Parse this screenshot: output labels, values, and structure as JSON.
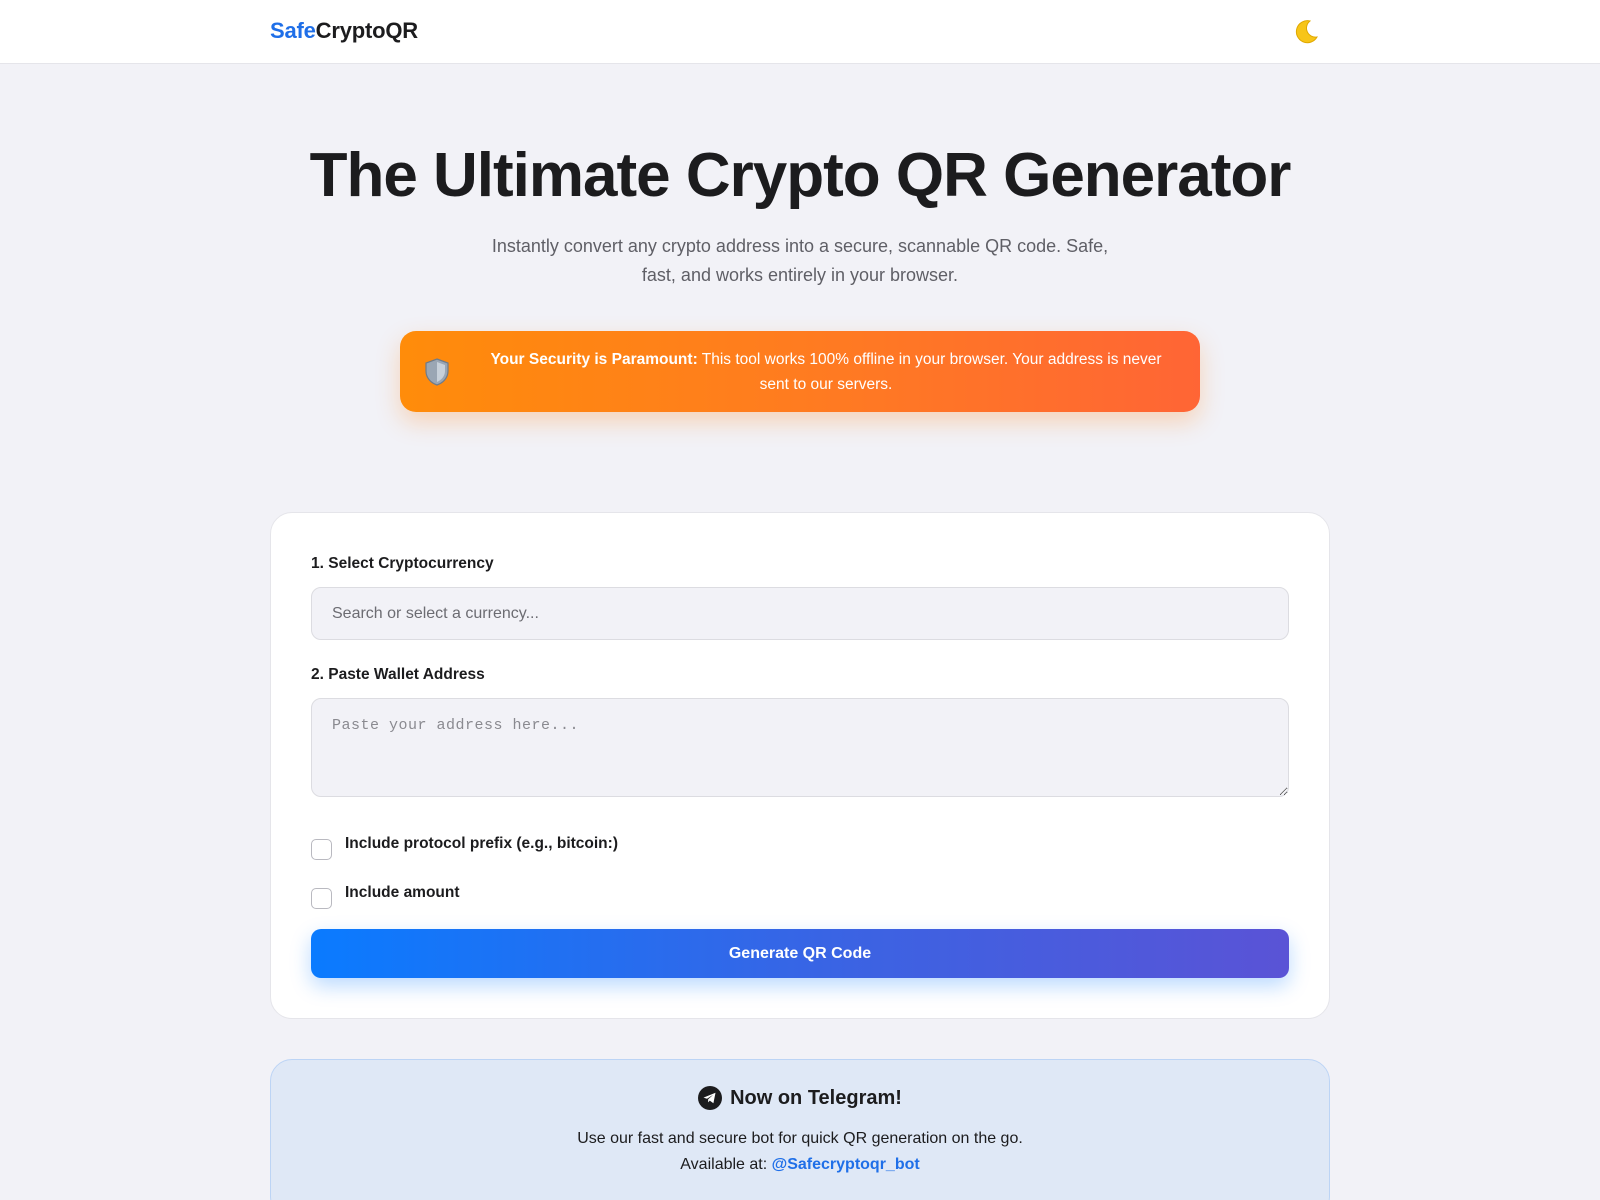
{
  "header": {
    "logo_accent": "Safe",
    "logo_rest": "CryptoQR",
    "theme_toggle_icon": "moon-icon"
  },
  "hero": {
    "title": "The Ultimate Crypto QR Generator",
    "subtitle_line1": "Instantly convert any crypto address into a secure, scannable QR code. Safe,",
    "subtitle_line2": "fast, and works entirely in your browser."
  },
  "security_banner": {
    "icon": "shield-icon",
    "strong": "Your Security is Paramount:",
    "text": "This tool works 100% offline in your browser. Your address is never sent to our servers."
  },
  "form": {
    "currency_label": "1. Select Cryptocurrency",
    "currency_value": "",
    "currency_placeholder": "Search or select a currency...",
    "address_label": "2. Paste Wallet Address",
    "address_value": "",
    "address_placeholder": "Paste your address here...",
    "options": [
      {
        "label": "Include protocol prefix (e.g., bitcoin:)",
        "checked": false
      },
      {
        "label": "Include amount",
        "checked": false
      }
    ],
    "generate_label": "Generate QR Code"
  },
  "telegram": {
    "icon": "telegram-icon",
    "title": "Now on Telegram!",
    "description": "Use our fast and secure bot for quick QR generation on the go.",
    "available_prefix": "Available at:",
    "bot_handle": "@Safecryptoqr_bot"
  },
  "colors": {
    "brand_blue": "#1f6fe8",
    "banner_orange": "#ff7a22",
    "button_blue": "#0a7bff",
    "page_bg": "#f2f2f7"
  }
}
